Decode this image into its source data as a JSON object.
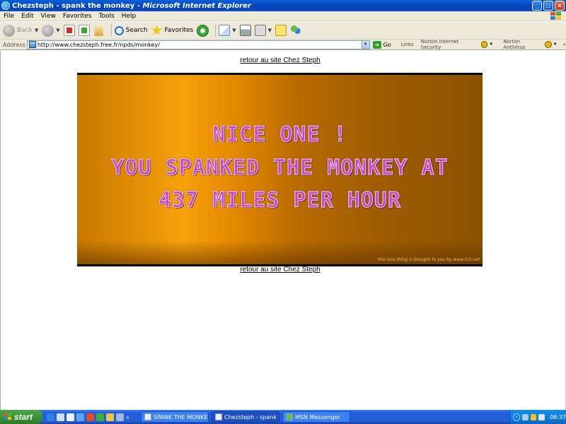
{
  "window": {
    "title_page": "Chezsteph - spank the monkey",
    "title_sep": " - ",
    "title_app": "Microsoft Internet Explorer",
    "btn_min": "_",
    "btn_max": "□",
    "btn_close": "×"
  },
  "menu": [
    "File",
    "Edit",
    "View",
    "Favorites",
    "Tools",
    "Help"
  ],
  "toolbar": {
    "back": "Back",
    "search": "Search",
    "favorites": "Favorites"
  },
  "address": {
    "label": "Address",
    "url": "http://www.chezsteph.free.fr/npds/monkey/",
    "go": "Go",
    "links": "Links",
    "norton_security": "Norton Internet Security",
    "norton_antivirus": "Norton AntiVirus"
  },
  "page": {
    "link_top": "retour au site Chez Steph",
    "link_bottom": "retour au site Chez Steph",
    "banner_line1": "NICE ONE !",
    "banner_line2": "YOU SPANKED THE MONKEY AT",
    "banner_line3": "437 MILES PER HOUR",
    "banner_credit": "this nice thing is brought to you by www.tc3.net"
  },
  "taskbar": {
    "start": "start",
    "tasks": [
      "SPANK THE MONKEY ...",
      "Chezsteph - spank th...",
      "MSN Messenger"
    ],
    "clock": "08:37"
  },
  "colors": {
    "xp_blue": "#245edb",
    "banner_orange": "#f7a10a",
    "banner_text": "#c94ab8"
  }
}
